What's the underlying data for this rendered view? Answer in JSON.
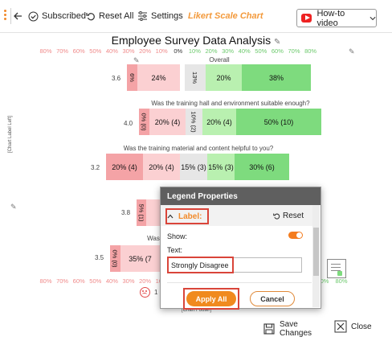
{
  "toolbar": {
    "subscribed": "Subscribed",
    "reset_all": "Reset All",
    "settings": "Settings",
    "app_title": "Likert Scale Chart",
    "howto": "How-to video"
  },
  "chart": {
    "title": "Employee Survey Data Analysis",
    "side_label": "[Chart Label Left]",
    "footer_label": "[Chart Footer]",
    "ticks_neg": [
      "80%",
      "70%",
      "60%",
      "50%",
      "40%",
      "30%",
      "20%",
      "10%"
    ],
    "tick_zero": "0%",
    "ticks_pos": [
      "10%",
      "20%",
      "30%",
      "40%",
      "50%",
      "60%",
      "70%",
      "80%"
    ],
    "bottom_left": "80%",
    "bottom_right_1": "0%",
    "bottom_right_2": "80%",
    "questions": {
      "q1": {
        "label": "Overall",
        "avg": "3.6",
        "s1": "6%",
        "s2": "24%",
        "s3": "13%",
        "s4": "20%",
        "s5": "38%"
      },
      "q2": {
        "label": "Was the training hall and environment suitable enough?",
        "avg": "4.0",
        "s1": "0% (0)",
        "s2": "20% (4)",
        "s3": "10% (2)",
        "s4": "20% (4)",
        "s5": "50% (10)"
      },
      "q3": {
        "label": "Was the training material and content helpful to you?",
        "avg": "3.2",
        "s1": "20% (4)",
        "s2": "20% (4)",
        "s3": "15% (3)",
        "s4": "15% (3)",
        "s5": "30% (6)"
      },
      "q4": {
        "avg": "3.8",
        "s1": "5% (1)"
      },
      "q5": {
        "label": "Was",
        "avg": "3.5",
        "s1": "0% (0)",
        "s2": "35% (7"
      }
    },
    "partial_digit": "1",
    "chart_data": {
      "type": "bar",
      "categories": [
        "Overall",
        "Was the training hall and environment suitable enough?",
        "Was the training material and content helpful to you?"
      ],
      "series": [
        {
          "values": [
            6,
            0,
            20
          ]
        },
        {
          "values": [
            24,
            20,
            20
          ]
        },
        {
          "values": [
            13,
            10,
            15
          ]
        },
        {
          "values": [
            20,
            20,
            15
          ]
        },
        {
          "values": [
            38,
            50,
            30
          ]
        }
      ],
      "xlim": [
        -80,
        80
      ],
      "colors": [
        "#f4a3a6",
        "#fbd0d2",
        "#e6e6e6",
        "#b9f0b0",
        "#7edb7e"
      ]
    }
  },
  "dialog": {
    "title": "Legend Properties",
    "section": "Label:",
    "reset": "Reset",
    "show_label": "Show:",
    "show_value": true,
    "text_label": "Text:",
    "text_value": "Strongly Disagree",
    "apply": "Apply All",
    "cancel": "Cancel"
  },
  "footer": {
    "save": "Save Changes",
    "close": "Close"
  },
  "colors": {
    "accent": "#f39a3c",
    "highlight": "#d9453a",
    "dialog_header": "#5f5f5f"
  }
}
